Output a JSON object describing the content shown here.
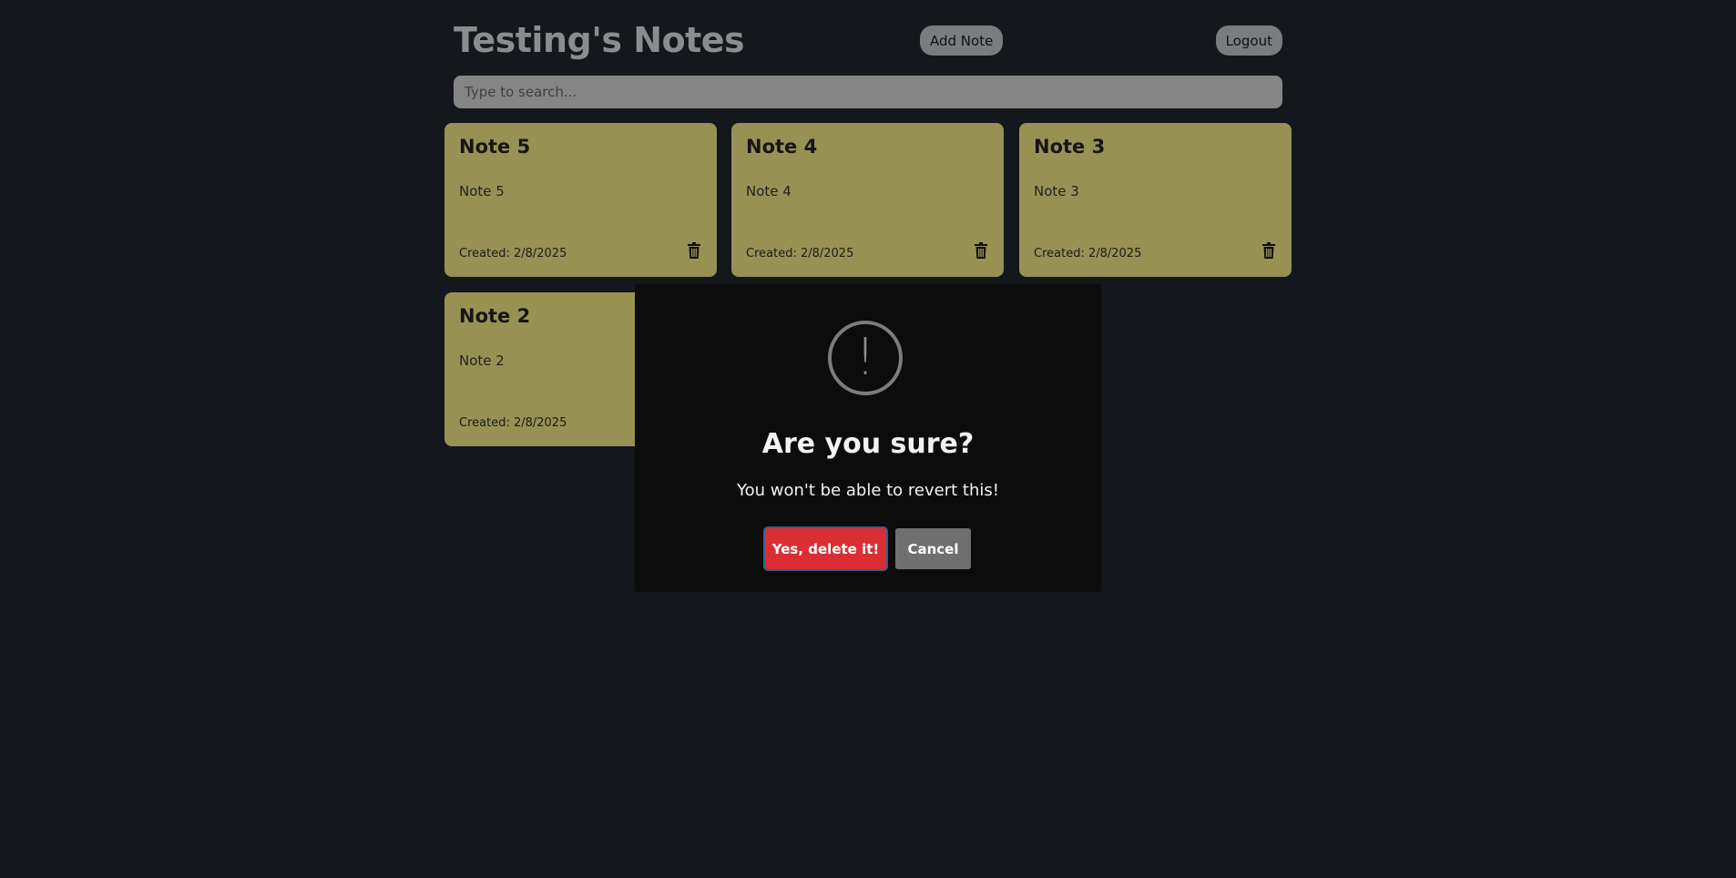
{
  "header": {
    "app_title": "Testing's Notes",
    "add_note_label": "Add Note",
    "logout_label": "Logout"
  },
  "search": {
    "placeholder": "Type to search...",
    "value": ""
  },
  "notes": [
    {
      "title": "Note 5",
      "body": "Note 5",
      "created": "Created: 2/8/2025"
    },
    {
      "title": "Note 4",
      "body": "Note 4",
      "created": "Created: 2/8/2025"
    },
    {
      "title": "Note 3",
      "body": "Note 3",
      "created": "Created: 2/8/2025"
    },
    {
      "title": "Note 2",
      "body": "Note 2",
      "created": "Created: 2/8/2025"
    }
  ],
  "dialog": {
    "icon": "exclamation-icon",
    "icon_glyph": "!",
    "title": "Are you sure?",
    "text": "You won't be able to revert this!",
    "confirm_label": "Yes, delete it!",
    "cancel_label": "Cancel"
  },
  "colors": {
    "background": "#14171b",
    "note_card": "#979254",
    "confirm": "#db2e34",
    "cancel": "#6f6f6f"
  }
}
